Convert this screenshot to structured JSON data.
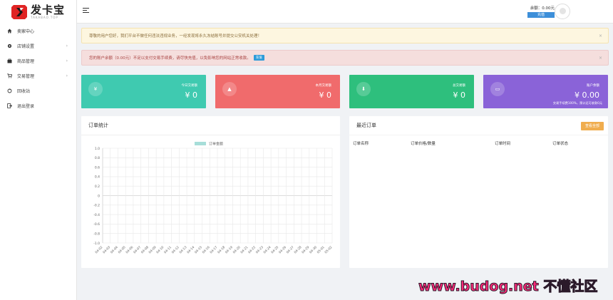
{
  "brand": {
    "name": "发卡宝",
    "sub": "TAKABAO.TOP"
  },
  "sidebar": {
    "items": [
      {
        "label": "卖家中心",
        "icon": "home-icon",
        "chev": ""
      },
      {
        "label": "店铺设置",
        "icon": "gear-icon",
        "chev": "›"
      },
      {
        "label": "商品管理",
        "icon": "bag-icon",
        "chev": "›"
      },
      {
        "label": "交易管理",
        "icon": "cart-icon",
        "chev": "›"
      },
      {
        "label": "回收站",
        "icon": "recycle-icon",
        "chev": ""
      },
      {
        "label": "退出登录",
        "icon": "logout-icon",
        "chev": ""
      }
    ]
  },
  "topbar": {
    "balance": "余额：0.00元",
    "recharge": "充值"
  },
  "alerts": {
    "warning": "尊敬的用户您好，我们平台不做任何违法违规业务，一经发现将永久冻结账号并提交公安机关处理！",
    "danger": "您的账户余额（0.00元）不足以支付交易手续费，请尽快充值，以免影响您的网站正常收款。",
    "danger_btn": "充值",
    "close": "×"
  },
  "cards": [
    {
      "label": "今日交易额",
      "value": "¥ 0",
      "color": "#3fcab0",
      "icon": "yen-icon",
      "glyph": "¥",
      "note": ""
    },
    {
      "label": "本月交易额",
      "value": "¥ 0",
      "color": "#f06b6c",
      "icon": "user-icon",
      "glyph": "▲",
      "note": ""
    },
    {
      "label": "总交易额",
      "value": "¥ 0",
      "color": "#2ebf7d",
      "icon": "download-icon",
      "glyph": "⬇",
      "note": ""
    },
    {
      "label": "账户余额",
      "value": "¥ 0.00",
      "color": "#8a63d8",
      "icon": "monitor-icon",
      "glyph": "▭",
      "note": "交易手续费100%，预计还可收款0元"
    }
  ],
  "orders_chart": {
    "title": "订单统计"
  },
  "recent_orders": {
    "title": "最近订单",
    "more": "查看全部",
    "columns": [
      "订单名称",
      "订单价格/数量",
      "订单时间",
      "订单状态"
    ]
  },
  "chart_data": {
    "type": "line",
    "title": "",
    "legend": [
      "订单金额"
    ],
    "legend_color": "#a7ded9",
    "x": [
      "04-02",
      "04-03",
      "04-04",
      "04-05",
      "04-06",
      "04-07",
      "04-08",
      "04-09",
      "04-10",
      "04-11",
      "04-12",
      "04-13",
      "04-14",
      "04-15",
      "04-16",
      "04-17",
      "04-18",
      "04-19",
      "04-20",
      "04-21",
      "04-22",
      "04-23",
      "04-24",
      "04-25",
      "04-26",
      "04-27",
      "04-28",
      "04-29",
      "04-30",
      "05-01",
      "05-02"
    ],
    "series": [
      {
        "name": "订单金额",
        "values": []
      }
    ],
    "ylim": [
      -1.0,
      1.0
    ],
    "yticks": [
      "1.0",
      "0.8",
      "0.6",
      "0.4",
      "0.2",
      "0",
      "-0.2",
      "-0.4",
      "-0.6",
      "-0.8",
      "-1.0"
    ],
    "grid": true
  },
  "watermark": {
    "text": "www.budog.net 不懂社区"
  }
}
